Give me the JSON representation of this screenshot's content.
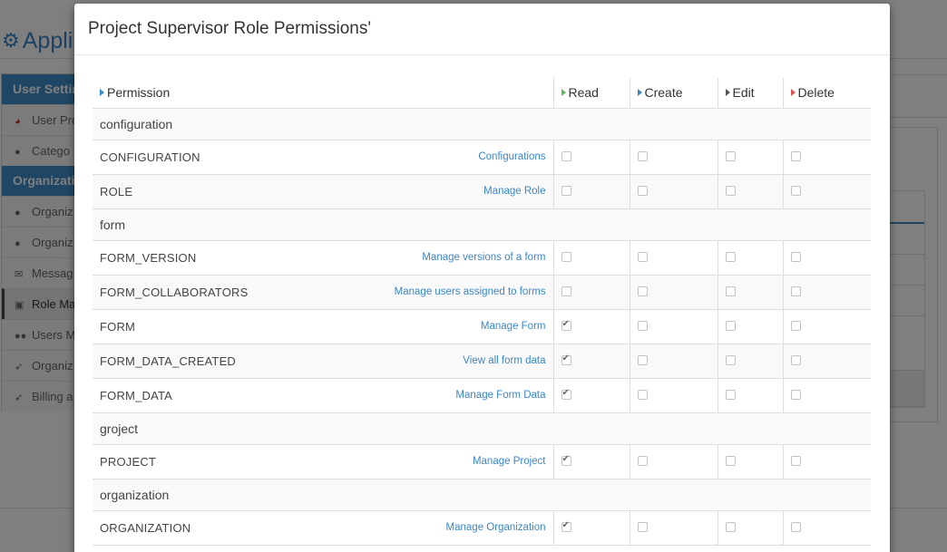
{
  "background": {
    "app_title": "Appli",
    "sidebar": {
      "section1": "User Setting",
      "items1": [
        {
          "label": "User Pro",
          "icon": "dashboard-icon"
        },
        {
          "label": "Catego",
          "icon": "user-icon"
        }
      ],
      "section2": "Organizatio",
      "items2": [
        {
          "label": "Organiz",
          "icon": "user-icon"
        },
        {
          "label": "Organiz",
          "icon": "user-icon"
        },
        {
          "label": "Messag",
          "icon": "envelope-icon"
        },
        {
          "label": "Role Ma",
          "icon": "lock-icon"
        },
        {
          "label": "Users M",
          "icon": "users-icon"
        },
        {
          "label": "Organiz",
          "icon": "rocket-icon"
        },
        {
          "label": "Billing a",
          "icon": "rocket-icon"
        }
      ]
    }
  },
  "modal": {
    "title": "Project Supervisor Role Permissions'",
    "columns": {
      "permission": "Permission",
      "read": "Read",
      "create": "Create",
      "edit": "Edit",
      "delete": "Delete"
    },
    "groups": [
      {
        "name": "configuration",
        "rows": [
          {
            "name": "CONFIGURATION",
            "link": "Configurations",
            "read": false,
            "create": false,
            "edit": false,
            "delete": false
          },
          {
            "name": "ROLE",
            "link": "Manage Role",
            "read": false,
            "create": false,
            "edit": false,
            "delete": false
          }
        ]
      },
      {
        "name": "form",
        "rows": [
          {
            "name": "FORM_VERSION",
            "link": "Manage versions of a form",
            "read": false,
            "create": false,
            "edit": false,
            "delete": false
          },
          {
            "name": "FORM_COLLABORATORS",
            "link": "Manage users assigned to forms",
            "read": false,
            "create": false,
            "edit": false,
            "delete": false
          },
          {
            "name": "FORM",
            "link": "Manage Form",
            "read": true,
            "create": false,
            "edit": false,
            "delete": false
          },
          {
            "name": "FORM_DATA_CREATED",
            "link": "View all form data",
            "read": true,
            "create": false,
            "edit": false,
            "delete": false
          },
          {
            "name": "FORM_DATA",
            "link": "Manage Form Data",
            "read": true,
            "create": false,
            "edit": false,
            "delete": false
          }
        ]
      },
      {
        "name": "groject",
        "rows": [
          {
            "name": "PROJECT",
            "link": "Manage Project",
            "read": true,
            "create": false,
            "edit": false,
            "delete": false
          }
        ]
      },
      {
        "name": "organization",
        "rows": [
          {
            "name": "ORGANIZATION",
            "link": "Manage Organization",
            "read": true,
            "create": false,
            "edit": false,
            "delete": false
          }
        ]
      }
    ]
  }
}
